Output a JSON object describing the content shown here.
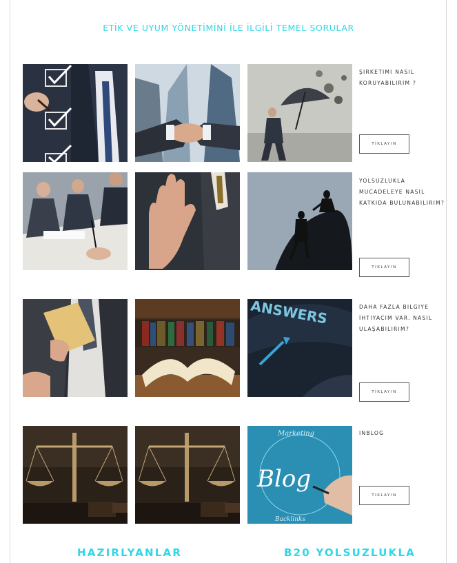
{
  "page": {
    "title": "ETİK VE UYUM YÖNETİMİNİ İLE İLGİLİ TEMEL SORULAR"
  },
  "questions": [
    {
      "text": "ŞIRKETIMI NASIL KORUYABILIRIM ?",
      "button": "TIKLAYIN"
    },
    {
      "text": "YOLSUZLUKLA MUCADELEYE NASIL KATKIDA BULUNABILIRIM?",
      "button": "TIKLAYIN"
    },
    {
      "text": "DAHA FAZLA BILGIYE İHTIYACIM VAR. NASIL ULAŞABILIRIM?",
      "button": "TIKLAYIN"
    },
    {
      "text": "INBLOG",
      "button": "TIKLAYIN"
    }
  ],
  "images": {
    "blog_word": "Blog",
    "answers_word": "ANSWERS",
    "marketing_word": "Marketing",
    "backlinks_word": "Backlinks"
  },
  "footer": {
    "left": "HAZIRLYANLAR",
    "right": "B20 YOLSUZLUKLA"
  },
  "colors": {
    "accent": "#2fd6e6"
  }
}
